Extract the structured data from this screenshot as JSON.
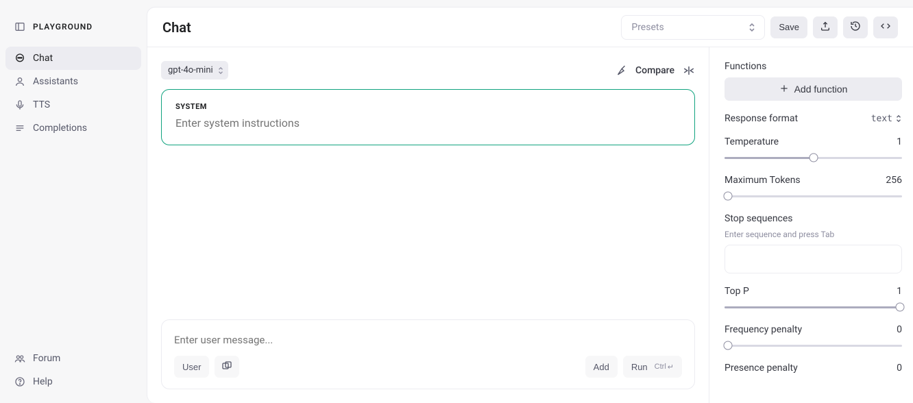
{
  "sidebar": {
    "header": "PLAYGROUND",
    "items": [
      {
        "label": "Chat"
      },
      {
        "label": "Assistants"
      },
      {
        "label": "TTS"
      },
      {
        "label": "Completions"
      }
    ],
    "footer": [
      {
        "label": "Forum"
      },
      {
        "label": "Help"
      }
    ]
  },
  "header": {
    "title": "Chat",
    "presets_placeholder": "Presets",
    "save_label": "Save"
  },
  "chat": {
    "model": "gpt-4o-mini",
    "compare_label": "Compare",
    "system_heading": "SYSTEM",
    "system_placeholder": "Enter system instructions",
    "user_placeholder": "Enter user message...",
    "user_btn": "User",
    "add_btn": "Add",
    "run_btn": "Run",
    "run_shortcut": "Ctrl",
    "run_shortcut_symbol": "↵"
  },
  "settings": {
    "functions_label": "Functions",
    "add_function_label": "Add function",
    "resp_format_label": "Response format",
    "resp_format_value": "text",
    "temperature": {
      "label": "Temperature",
      "value": "1"
    },
    "max_tokens": {
      "label": "Maximum Tokens",
      "value": "256"
    },
    "stop": {
      "label": "Stop sequences",
      "hint": "Enter sequence and press Tab"
    },
    "top_p": {
      "label": "Top P",
      "value": "1"
    },
    "freq_penalty": {
      "label": "Frequency penalty",
      "value": "0"
    },
    "pres_penalty": {
      "label": "Presence penalty",
      "value": "0"
    }
  }
}
